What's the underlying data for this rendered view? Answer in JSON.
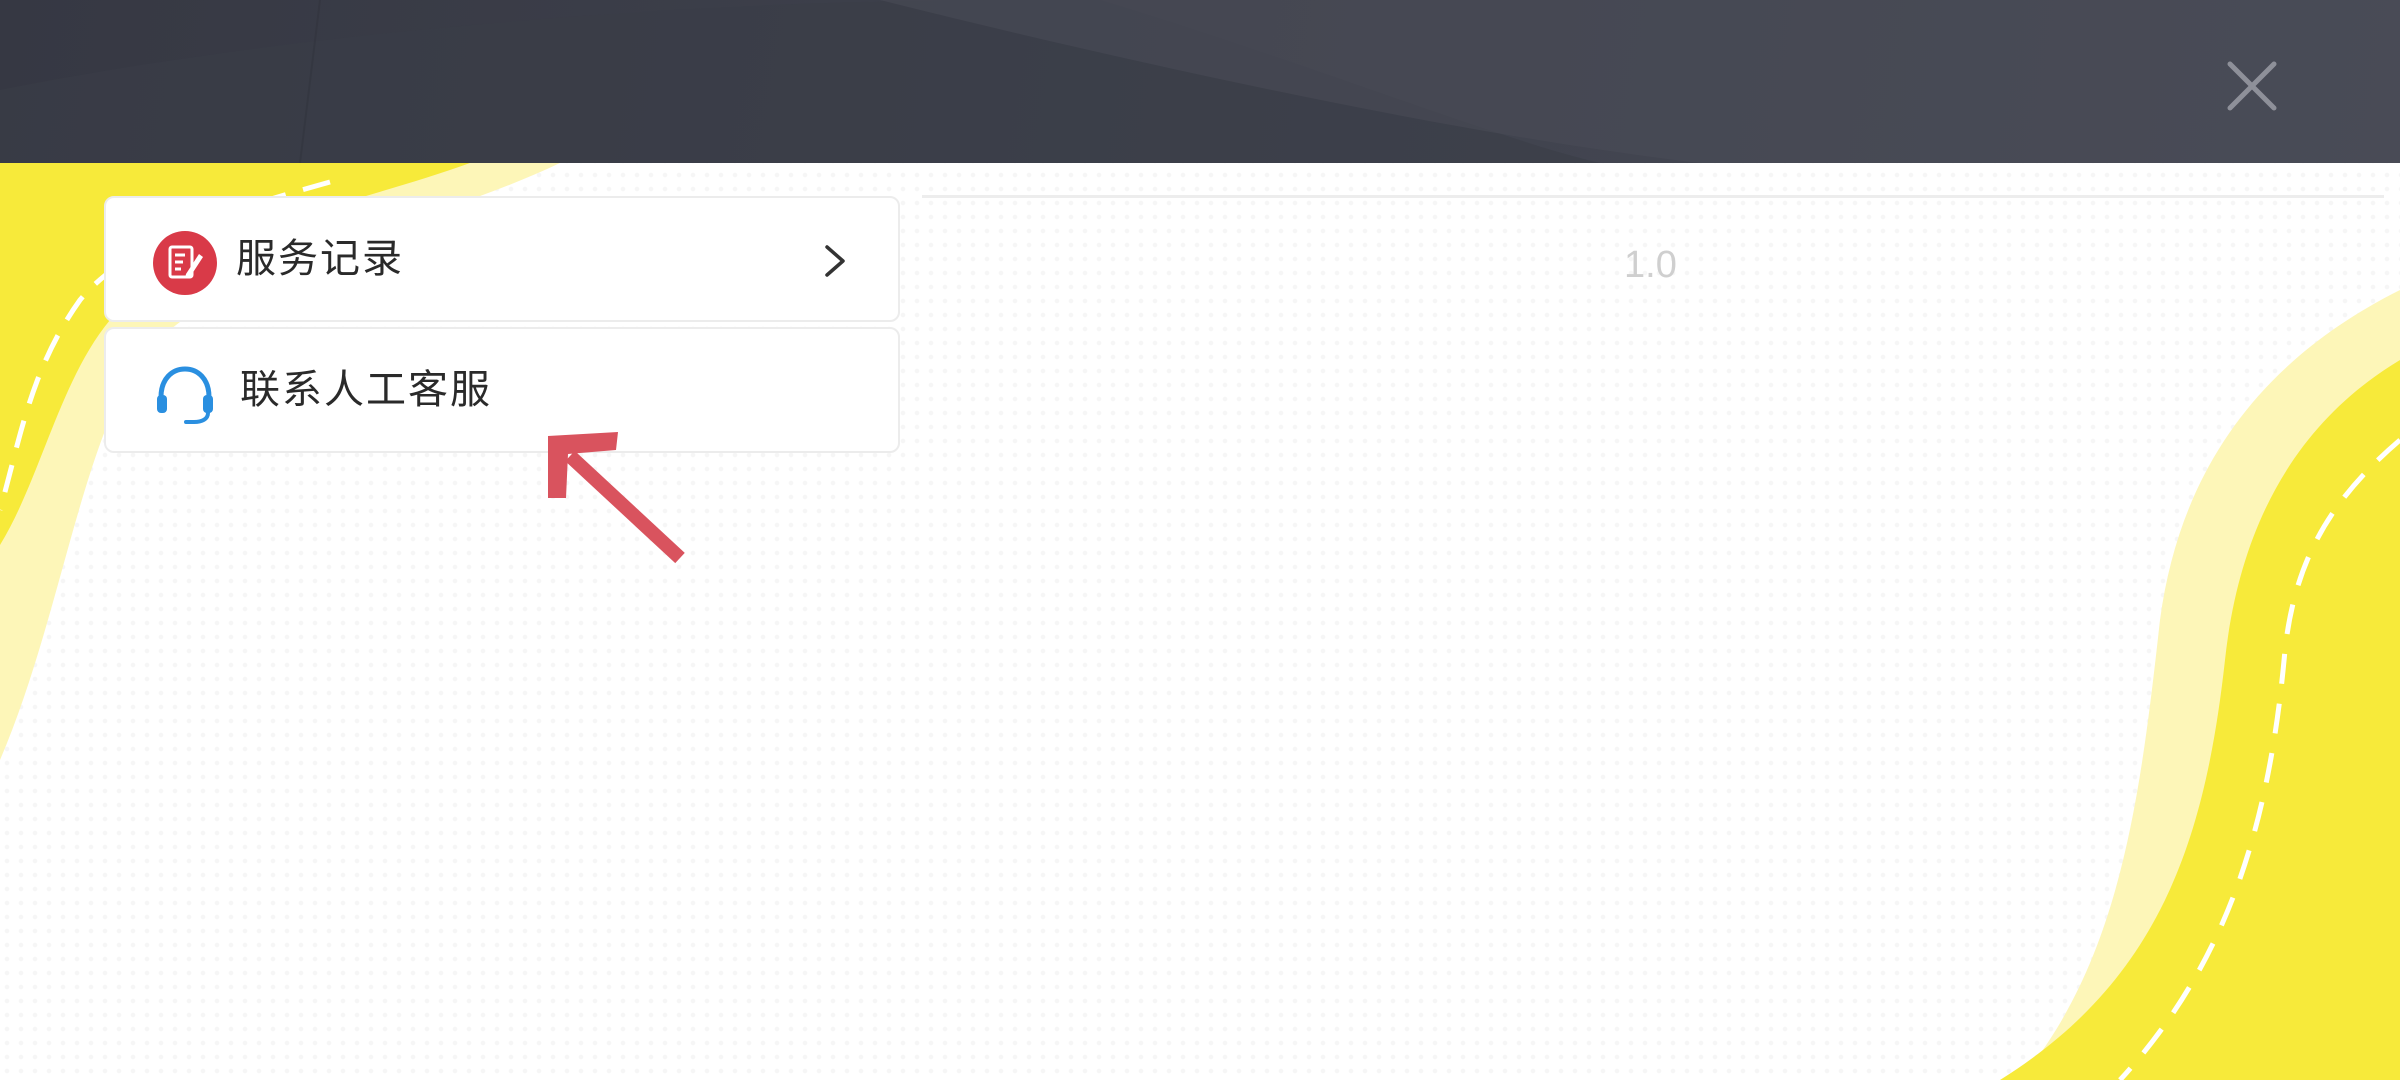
{
  "theme": {
    "accent_yellow": "#f7ea3a",
    "pale_yellow": "#fdf6b8",
    "header_dark": "#3b3e49",
    "record_icon_red": "#d93a48",
    "headset_icon_blue": "#2a8fe0",
    "arrow_red": "#d9535e"
  },
  "header": {
    "close_icon": "close-icon"
  },
  "menu": {
    "items": [
      {
        "label": "服务记录",
        "icon": "edit-record-icon",
        "has_chevron": true
      },
      {
        "label": "联系人工客服",
        "icon": "headset-icon",
        "has_chevron": false
      }
    ]
  },
  "version": "1.0",
  "annotation": {
    "icon": "red-arrow-pointer-icon"
  }
}
